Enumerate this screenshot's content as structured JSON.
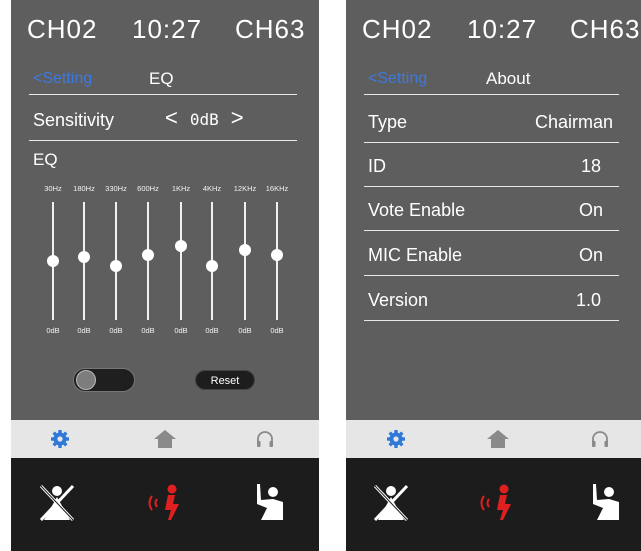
{
  "status": {
    "left_channel": "CH02",
    "time": "10:27",
    "right_channel": "CH63"
  },
  "eq_screen": {
    "back_label": "<Setting",
    "title": "EQ",
    "sensitivity": {
      "label": "Sensitivity",
      "decrease": "<",
      "value": "0dB",
      "increase": ">"
    },
    "eq_label": "EQ",
    "bands": [
      {
        "freq": "30Hz",
        "db": "0dB",
        "level": 0.5
      },
      {
        "freq": "180Hz",
        "db": "0dB",
        "level": 0.53
      },
      {
        "freq": "330Hz",
        "db": "0dB",
        "level": 0.46
      },
      {
        "freq": "600Hz",
        "db": "0dB",
        "level": 0.55
      },
      {
        "freq": "1KHz",
        "db": "0dB",
        "level": 0.63
      },
      {
        "freq": "4KHz",
        "db": "0dB",
        "level": 0.46
      },
      {
        "freq": "12KHz",
        "db": "0dB",
        "level": 0.59
      },
      {
        "freq": "16KHz",
        "db": "0dB",
        "level": 0.55
      }
    ],
    "toggle_on": false,
    "reset_label": "Reset"
  },
  "about_screen": {
    "back_label": "<Setting",
    "title": "About",
    "rows": [
      {
        "label": "Type",
        "value": "Chairman"
      },
      {
        "label": "ID",
        "value": "18"
      },
      {
        "label": "Vote Enable",
        "value": "On"
      },
      {
        "label": "MIC Enable",
        "value": "On"
      },
      {
        "label": "Version",
        "value": "1.0"
      }
    ]
  },
  "tabs": [
    {
      "icon": "settings-gear-icon",
      "active": true
    },
    {
      "icon": "home-icon",
      "active": false
    },
    {
      "icon": "headphones-icon",
      "active": false
    }
  ],
  "actions": [
    {
      "icon": "mic-off-person-icon"
    },
    {
      "icon": "speaking-icon"
    },
    {
      "icon": "raise-hand-request-icon"
    }
  ],
  "colors": {
    "accent_blue": "#3c7ae0",
    "speak_red": "#e02020",
    "screen_bg": "#5f5e5e",
    "action_bg": "#1c1c1c",
    "tab_bg": "#e6e6e6"
  }
}
